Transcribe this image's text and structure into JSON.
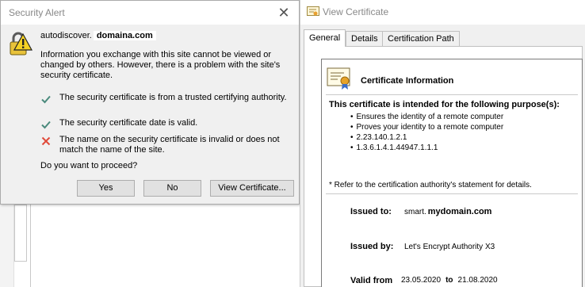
{
  "security_alert": {
    "title": "Security Alert",
    "close_glyph": "✕",
    "host_prefix": "autodiscover.",
    "host_domain": "domaina.com",
    "info_text": "Information you exchange with this site cannot be viewed or changed by others. However, there is a problem with the site's security certificate.",
    "checks": [
      {
        "status": "ok",
        "icon": "green-check-icon",
        "text": "The security certificate is from a trusted certifying authority."
      },
      {
        "status": "ok",
        "icon": "green-check-icon",
        "text": "The security certificate date is valid."
      },
      {
        "status": "error",
        "icon": "red-x-icon",
        "text": "The name on the security certificate is invalid or does not match the name of the site."
      }
    ],
    "question": "Do you want to proceed?",
    "buttons": {
      "yes": "Yes",
      "no": "No",
      "view_certificate": "View Certificate..."
    },
    "colors": {
      "ok": "#4a8a7c",
      "error": "#e04a3a"
    }
  },
  "view_certificate": {
    "title": "View Certificate",
    "tabs": [
      "General",
      "Details",
      "Certification Path"
    ],
    "active_tab": "General",
    "info_title": "Certificate Information",
    "purpose_heading": "This certificate is intended for the following purpose(s):",
    "purposes": [
      "Ensures the identity of a remote computer",
      "Proves your identity to a remote computer",
      "2.23.140.1.2.1",
      "1.3.6.1.4.1.44947.1.1.1"
    ],
    "refer_note": "* Refer to the certification authority's statement for details.",
    "issued_to_label": "Issued to:",
    "issued_to_prefix": "smart.",
    "issued_to_domain": "mydomain.com",
    "issued_by_label": "Issued by:",
    "issued_by_value": "Let's Encrypt Authority X3",
    "valid_from_label": "Valid from",
    "valid_from": "23.05.2020",
    "valid_to_word": "to",
    "valid_to": "21.08.2020"
  }
}
